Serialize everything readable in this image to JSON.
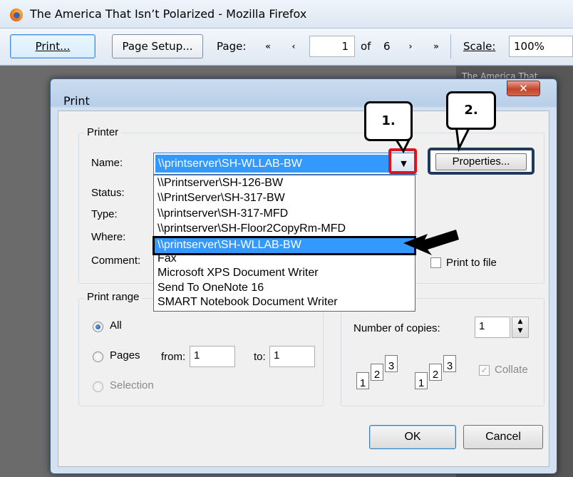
{
  "window": {
    "title": "The America That Isn’t Polarized - Mozilla Firefox"
  },
  "toolbar": {
    "print_label": "Print...",
    "page_setup_label": "Page Setup...",
    "page_label": "Page:",
    "page_value": "1",
    "of_label": "of",
    "page_count": "6",
    "scale_label": "Scale:",
    "scale_value": "100%",
    "nav_first": "«",
    "nav_prev": "‹",
    "nav_next": "›",
    "nav_last": "»"
  },
  "preview": {
    "text": "The America That"
  },
  "dialog": {
    "title": "Print",
    "close_glyph": "✕",
    "printer_group": "Printer",
    "name_label": "Name:",
    "name_value": "\\\\printserver\\SH-WLLAB-BW",
    "status_label": "Status:",
    "type_label": "Type:",
    "where_label": "Where:",
    "comment_label": "Comment:",
    "properties_label": "Properties...",
    "print_to_file_label": "Print to file",
    "printer_options": [
      "\\\\Printserver\\SH-126-BW",
      "\\\\PrintServer\\SH-317-BW",
      "\\\\printserver\\SH-317-MFD",
      "\\\\printserver\\SH-Floor2CopyRm-MFD",
      "\\\\printserver\\SH-WLLAB-BW",
      "Fax",
      "Microsoft XPS Document Writer",
      "Send To OneNote 16",
      "SMART Notebook Document Writer"
    ],
    "print_range_group": "Print range",
    "all_label": "All",
    "pages_label": "Pages",
    "from_label": "from:",
    "from_value": "1",
    "to_label": "to:",
    "to_value": "1",
    "selection_label": "Selection",
    "copies_label": "Number of copies:",
    "copies_value": "1",
    "collate_label": "Collate",
    "ok_label": "OK",
    "cancel_label": "Cancel"
  },
  "annotations": {
    "callout_1": "1.",
    "callout_2": "2."
  }
}
